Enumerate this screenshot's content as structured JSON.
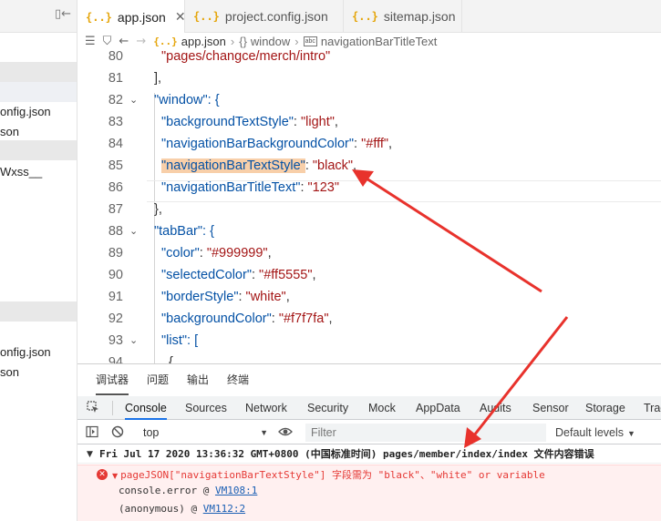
{
  "sidebar": {
    "files": [
      {
        "label": "onfig.json"
      },
      {
        "label": "son"
      },
      {
        "label": "Wxss__"
      },
      {
        "label": "onfig.json"
      },
      {
        "label": "son"
      }
    ],
    "split_icon": "split-editor-icon"
  },
  "tabs": [
    {
      "label": "app.json",
      "active": true,
      "close": "✕"
    },
    {
      "label": "project.config.json",
      "active": false
    },
    {
      "label": "sitemap.json",
      "active": false
    }
  ],
  "tab_icon_text": "{..}",
  "breadcrumb": {
    "file": "app.json",
    "items": [
      "window",
      "navigationBarTitleText"
    ],
    "object_icon_text": "{}",
    "prop_icon_text": "abc"
  },
  "editor": {
    "lines": [
      {
        "n": "80",
        "text": "\"pages/changce/merch/intro\""
      },
      {
        "n": "81",
        "text": "],"
      },
      {
        "n": "82",
        "text": "\"window\": {"
      },
      {
        "n": "83",
        "key": "backgroundTextStyle",
        "val": "light"
      },
      {
        "n": "84",
        "key": "navigationBarBackgroundColor",
        "val": "#fff"
      },
      {
        "n": "85",
        "key": "navigationBarTextStyle",
        "val": "black"
      },
      {
        "n": "86",
        "key": "navigationBarTitleText",
        "val": "123"
      },
      {
        "n": "87",
        "text": "},"
      },
      {
        "n": "88",
        "text": "\"tabBar\": {"
      },
      {
        "n": "89",
        "key": "color",
        "val": "#999999"
      },
      {
        "n": "90",
        "key": "selectedColor",
        "val": "#ff5555"
      },
      {
        "n": "91",
        "key": "borderStyle",
        "val": "white"
      },
      {
        "n": "92",
        "key": "backgroundColor",
        "val": "#f7f7fa"
      },
      {
        "n": "93",
        "text": "\"list\": ["
      },
      {
        "n": "94",
        "text": "{"
      }
    ]
  },
  "panel_tabs": [
    "调试器",
    "问题",
    "输出",
    "终端"
  ],
  "devtools_tabs": [
    "Console",
    "Sources",
    "Network",
    "Security",
    "Mock",
    "AppData",
    "Audits",
    "Sensor",
    "Storage",
    "Trace"
  ],
  "console": {
    "context": "top",
    "filter_placeholder": "Filter",
    "levels": "Default levels",
    "group_message": "Fri Jul 17 2020 13:36:32 GMT+0800 (中国标准时间)  pages/member/index/index 文件内容错误",
    "error_message": "pageJSON[\"navigationBarTextStyle\"] 字段需为 \"black\"、\"white\" or variable",
    "trace": [
      {
        "fn": "console.error @ ",
        "link": "VM108:1"
      },
      {
        "fn": "(anonymous)   @ ",
        "link": "VM112:2"
      }
    ]
  },
  "colors": {
    "key": "#0451a5",
    "string": "#a31515",
    "highlight": "#f8cfa9",
    "error": "#e53935",
    "arrow": "#e8322c",
    "active_tab_underline": "#1a73e8"
  }
}
